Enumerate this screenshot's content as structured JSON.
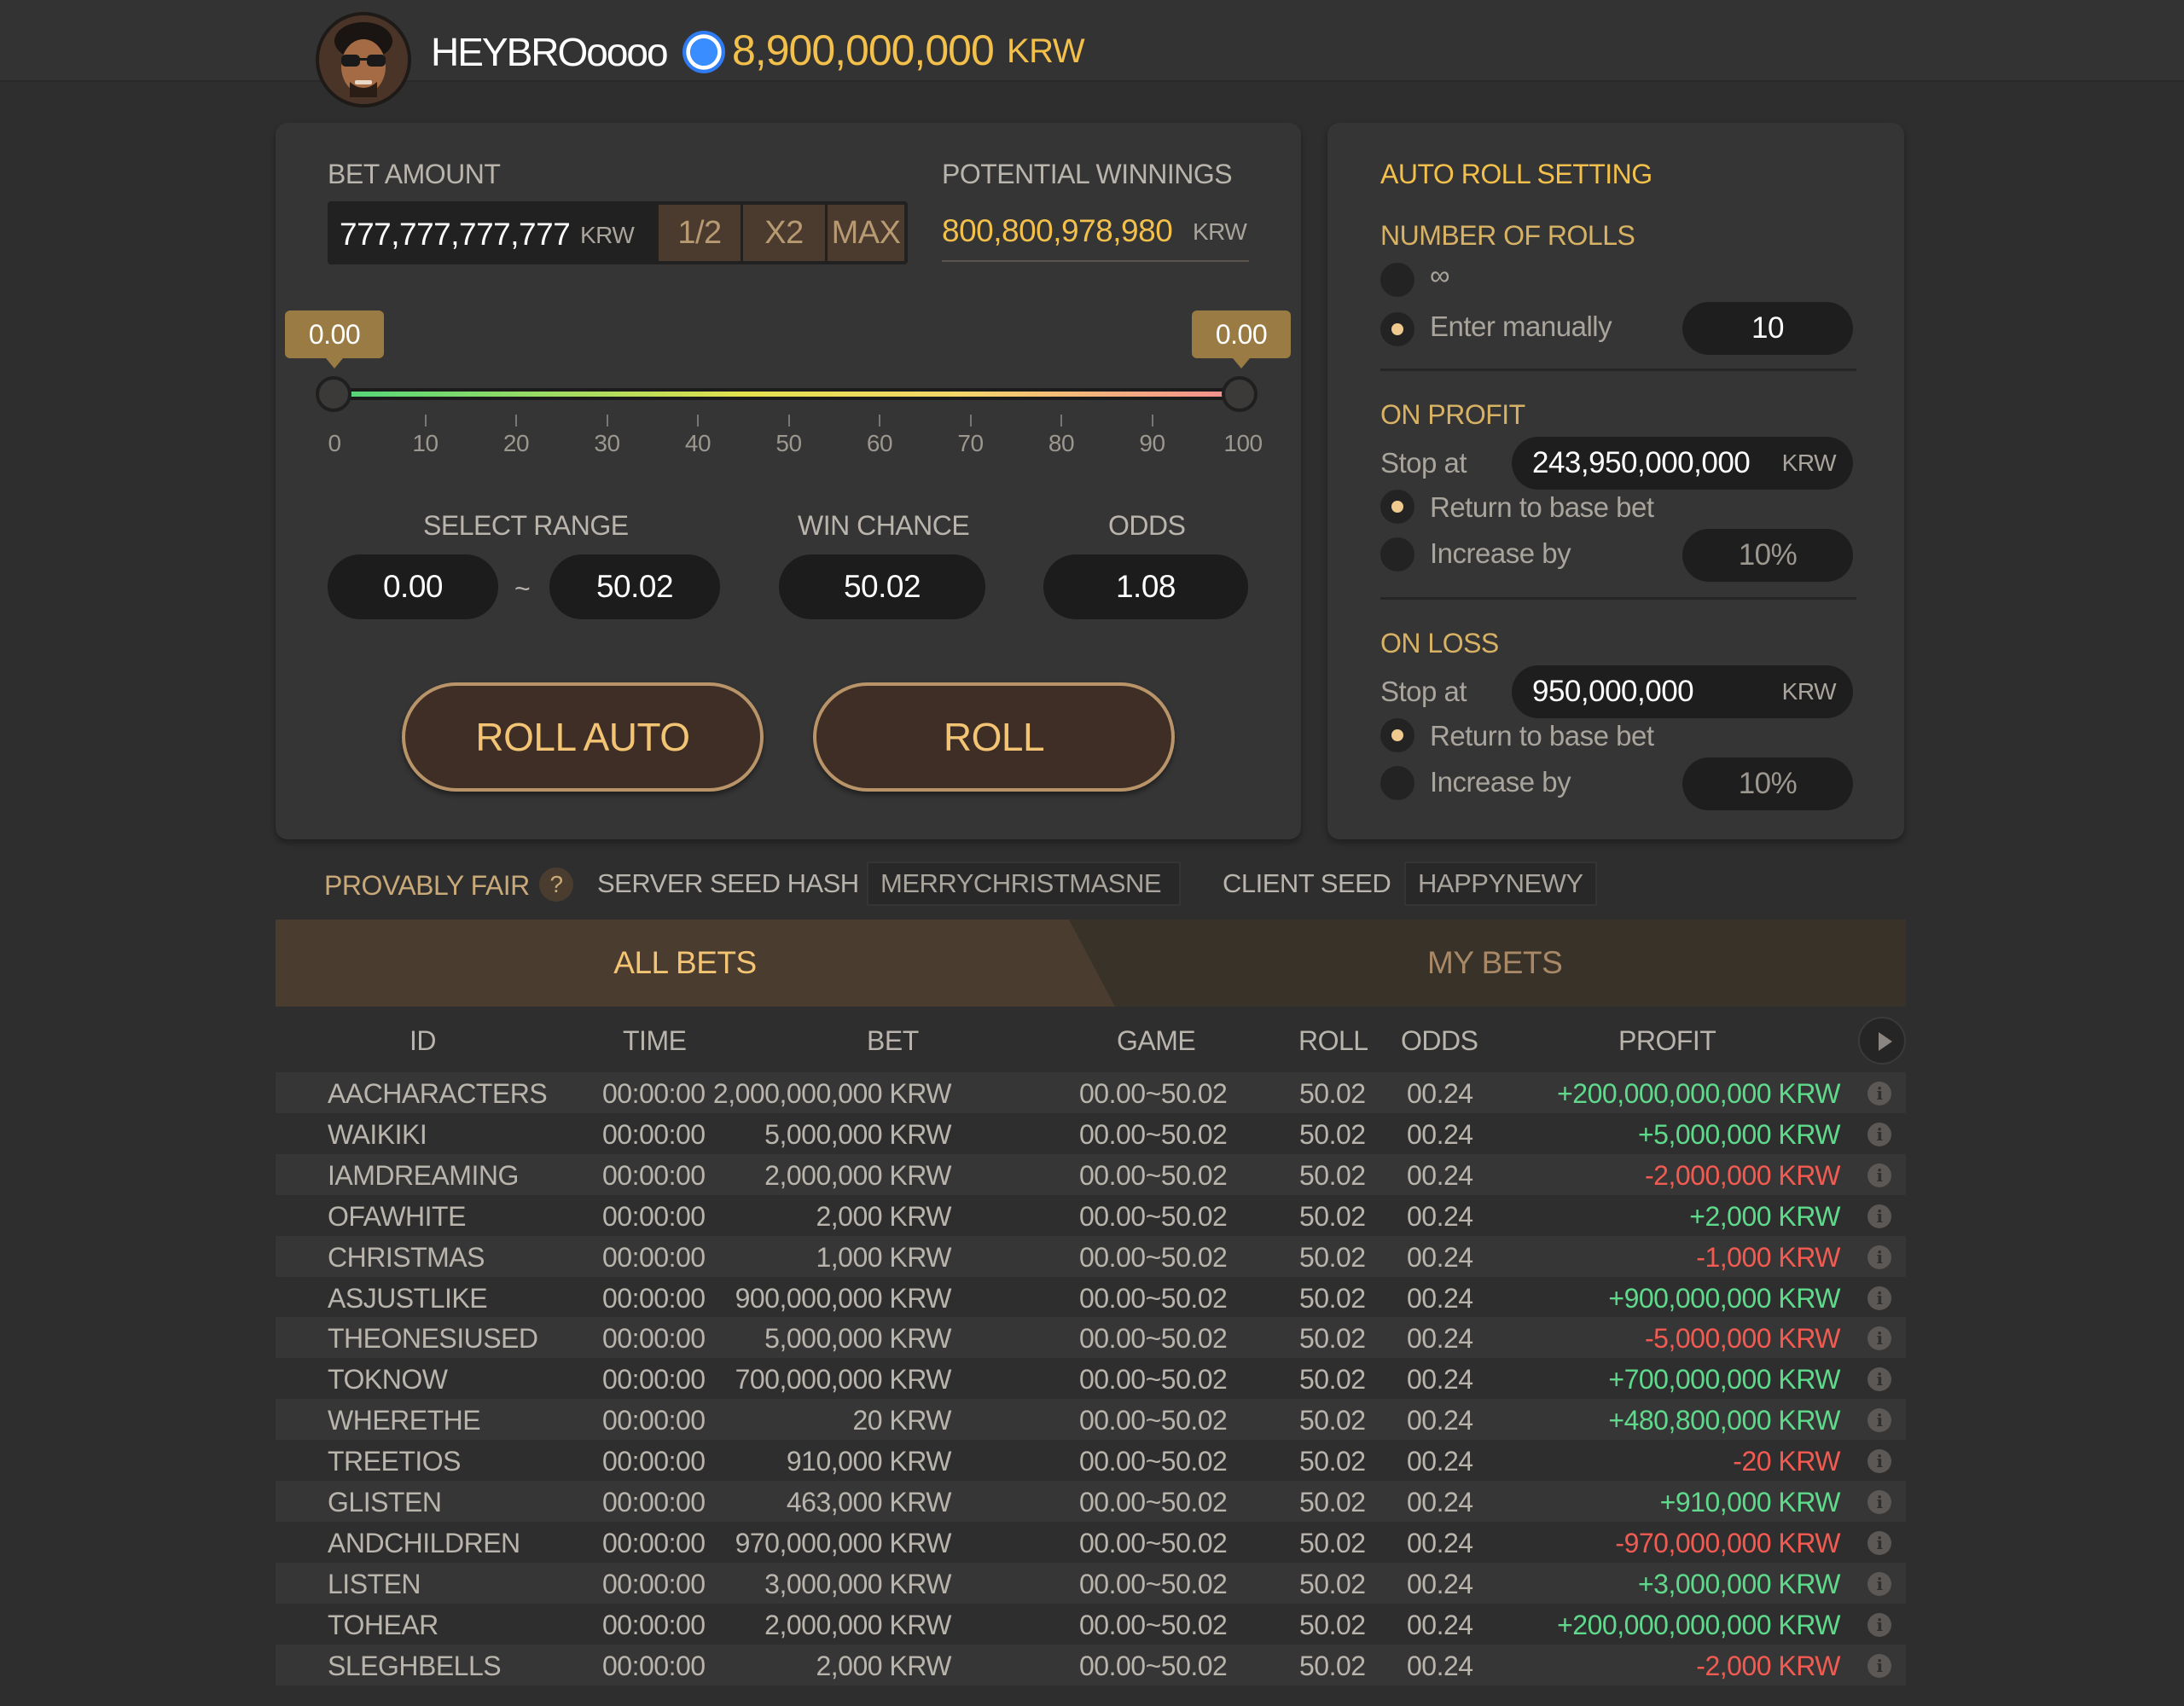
{
  "header": {
    "username": "HEYBROoooo",
    "balance": "8,900,000,000",
    "currency": "KRW",
    "chip_icon": "blue-poker-chip-icon"
  },
  "bet": {
    "label": "BET AMOUNT",
    "value": "777,777,777,777",
    "currency": "KRW",
    "half_label": "1/2",
    "double_label": "X2",
    "max_label": "MAX"
  },
  "potential": {
    "label": "POTENTIAL WINNINGS",
    "value": "800,800,978,980",
    "currency": "KRW"
  },
  "slider": {
    "left_value": "0.00",
    "right_value": "0.00",
    "ticks": [
      "0",
      "10",
      "20",
      "30",
      "40",
      "50",
      "60",
      "70",
      "80",
      "90",
      "100"
    ]
  },
  "range": {
    "label": "SELECT RANGE",
    "from": "0.00",
    "separator": "~",
    "to": "50.02"
  },
  "win_chance": {
    "label": "WIN CHANCE",
    "value": "50.02"
  },
  "odds": {
    "label": "ODDS",
    "value": "1.08"
  },
  "buttons": {
    "roll_auto": "ROLL AUTO",
    "roll": "ROLL"
  },
  "auto": {
    "title": "AUTO ROLL SETTING",
    "rolls_label": "NUMBER OF ROLLS",
    "infinite_label": "∞",
    "manual_label": "Enter manually",
    "manual_value": "10",
    "on_profit": {
      "title": "ON PROFIT",
      "stop_label": "Stop at",
      "stop_value": "243,950,000,000",
      "currency": "KRW",
      "return_label": "Return to base bet",
      "increase_label": "Increase by",
      "increase_value": "10%"
    },
    "on_loss": {
      "title": "ON LOSS",
      "stop_label": "Stop at",
      "stop_value": "950,000,000",
      "currency": "KRW",
      "return_label": "Return to base bet",
      "increase_label": "Increase by",
      "increase_value": "10%"
    }
  },
  "fair": {
    "label": "PROVABLY FAIR",
    "help": "?",
    "server_label": "SERVER SEED HASH",
    "server_value": "MERRYCHRISTMASNE",
    "client_label": "CLIENT SEED",
    "client_value": "HAPPYNEWY"
  },
  "tabs": {
    "all": "ALL BETS",
    "mine": "MY BETS"
  },
  "table": {
    "headers": {
      "id": "ID",
      "time": "TIME",
      "bet": "BET",
      "game": "GAME",
      "roll": "ROLL",
      "odds": "ODDS",
      "profit": "PROFIT"
    },
    "rows": [
      {
        "id": "AACHARACTERS",
        "time": "00:00:00",
        "bet": "2,000,000,000 KRW",
        "game": "00.00~50.02",
        "roll": "50.02",
        "odds": "00.24",
        "profit": "+200,000,000,000 KRW",
        "status": "win"
      },
      {
        "id": "WAIKIKI",
        "time": "00:00:00",
        "bet": "5,000,000 KRW",
        "game": "00.00~50.02",
        "roll": "50.02",
        "odds": "00.24",
        "profit": "+5,000,000 KRW",
        "status": "win"
      },
      {
        "id": "IAMDREAMING",
        "time": "00:00:00",
        "bet": "2,000,000 KRW",
        "game": "00.00~50.02",
        "roll": "50.02",
        "odds": "00.24",
        "profit": "-2,000,000 KRW",
        "status": "loss"
      },
      {
        "id": "OFAWHITE",
        "time": "00:00:00",
        "bet": "2,000 KRW",
        "game": "00.00~50.02",
        "roll": "50.02",
        "odds": "00.24",
        "profit": "+2,000 KRW",
        "status": "win"
      },
      {
        "id": "CHRISTMAS",
        "time": "00:00:00",
        "bet": "1,000 KRW",
        "game": "00.00~50.02",
        "roll": "50.02",
        "odds": "00.24",
        "profit": "-1,000 KRW",
        "status": "loss"
      },
      {
        "id": "ASJUSTLIKE",
        "time": "00:00:00",
        "bet": "900,000,000 KRW",
        "game": "00.00~50.02",
        "roll": "50.02",
        "odds": "00.24",
        "profit": "+900,000,000 KRW",
        "status": "win"
      },
      {
        "id": "THEONESIUSED",
        "time": "00:00:00",
        "bet": "5,000,000 KRW",
        "game": "00.00~50.02",
        "roll": "50.02",
        "odds": "00.24",
        "profit": "-5,000,000 KRW",
        "status": "loss"
      },
      {
        "id": "TOKNOW",
        "time": "00:00:00",
        "bet": "700,000,000 KRW",
        "game": "00.00~50.02",
        "roll": "50.02",
        "odds": "00.24",
        "profit": "+700,000,000 KRW",
        "status": "win"
      },
      {
        "id": "WHERETHE",
        "time": "00:00:00",
        "bet": "20 KRW",
        "game": "00.00~50.02",
        "roll": "50.02",
        "odds": "00.24",
        "profit": "+480,800,000 KRW",
        "status": "win"
      },
      {
        "id": "TREETIOS",
        "time": "00:00:00",
        "bet": "910,000 KRW",
        "game": "00.00~50.02",
        "roll": "50.02",
        "odds": "00.24",
        "profit": "-20 KRW",
        "status": "loss"
      },
      {
        "id": "GLISTEN",
        "time": "00:00:00",
        "bet": "463,000 KRW",
        "game": "00.00~50.02",
        "roll": "50.02",
        "odds": "00.24",
        "profit": "+910,000 KRW",
        "status": "win"
      },
      {
        "id": "ANDCHILDREN",
        "time": "00:00:00",
        "bet": "970,000,000 KRW",
        "game": "00.00~50.02",
        "roll": "50.02",
        "odds": "00.24",
        "profit": "-970,000,000 KRW",
        "status": "loss"
      },
      {
        "id": "LISTEN",
        "time": "00:00:00",
        "bet": "3,000,000 KRW",
        "game": "00.00~50.02",
        "roll": "50.02",
        "odds": "00.24",
        "profit": "+3,000,000 KRW",
        "status": "win"
      },
      {
        "id": "TOHEAR",
        "time": "00:00:00",
        "bet": "2,000,000 KRW",
        "game": "00.00~50.02",
        "roll": "50.02",
        "odds": "00.24",
        "profit": "+200,000,000,000 KRW",
        "status": "win"
      },
      {
        "id": "SLEGHBELLS",
        "time": "00:00:00",
        "bet": "2,000 KRW",
        "game": "00.00~50.02",
        "roll": "50.02",
        "odds": "00.24",
        "profit": "-2,000 KRW",
        "status": "loss"
      }
    ]
  },
  "colors": {
    "accent": "#f3c04b",
    "win": "#5fd98b",
    "loss": "#f25b52",
    "button_bg": "#3f2e25",
    "button_border": "#b99469"
  }
}
